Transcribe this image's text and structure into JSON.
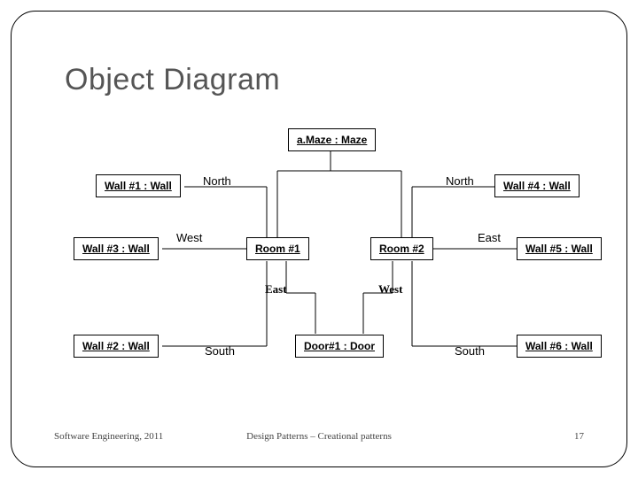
{
  "title": "Object Diagram",
  "footer": {
    "left": "Software Engineering, 2011",
    "center": "Design Patterns – Creational patterns",
    "right": "17"
  },
  "objects": {
    "maze": "a.Maze : Maze",
    "wall1": "Wall #1 : Wall",
    "wall2": "Wall #2 : Wall",
    "wall3": "Wall #3 : Wall",
    "wall4": "Wall #4 : Wall",
    "wall5": "Wall #5 : Wall",
    "wall6": "Wall #6 : Wall",
    "room1": "Room #1",
    "room2": "Room #2",
    "door1": "Door#1 : Door"
  },
  "labels": {
    "north1": "North",
    "north2": "North",
    "west1": "West",
    "east2": "East",
    "east": "East",
    "west": "West",
    "south1": "South",
    "south2": "South"
  }
}
